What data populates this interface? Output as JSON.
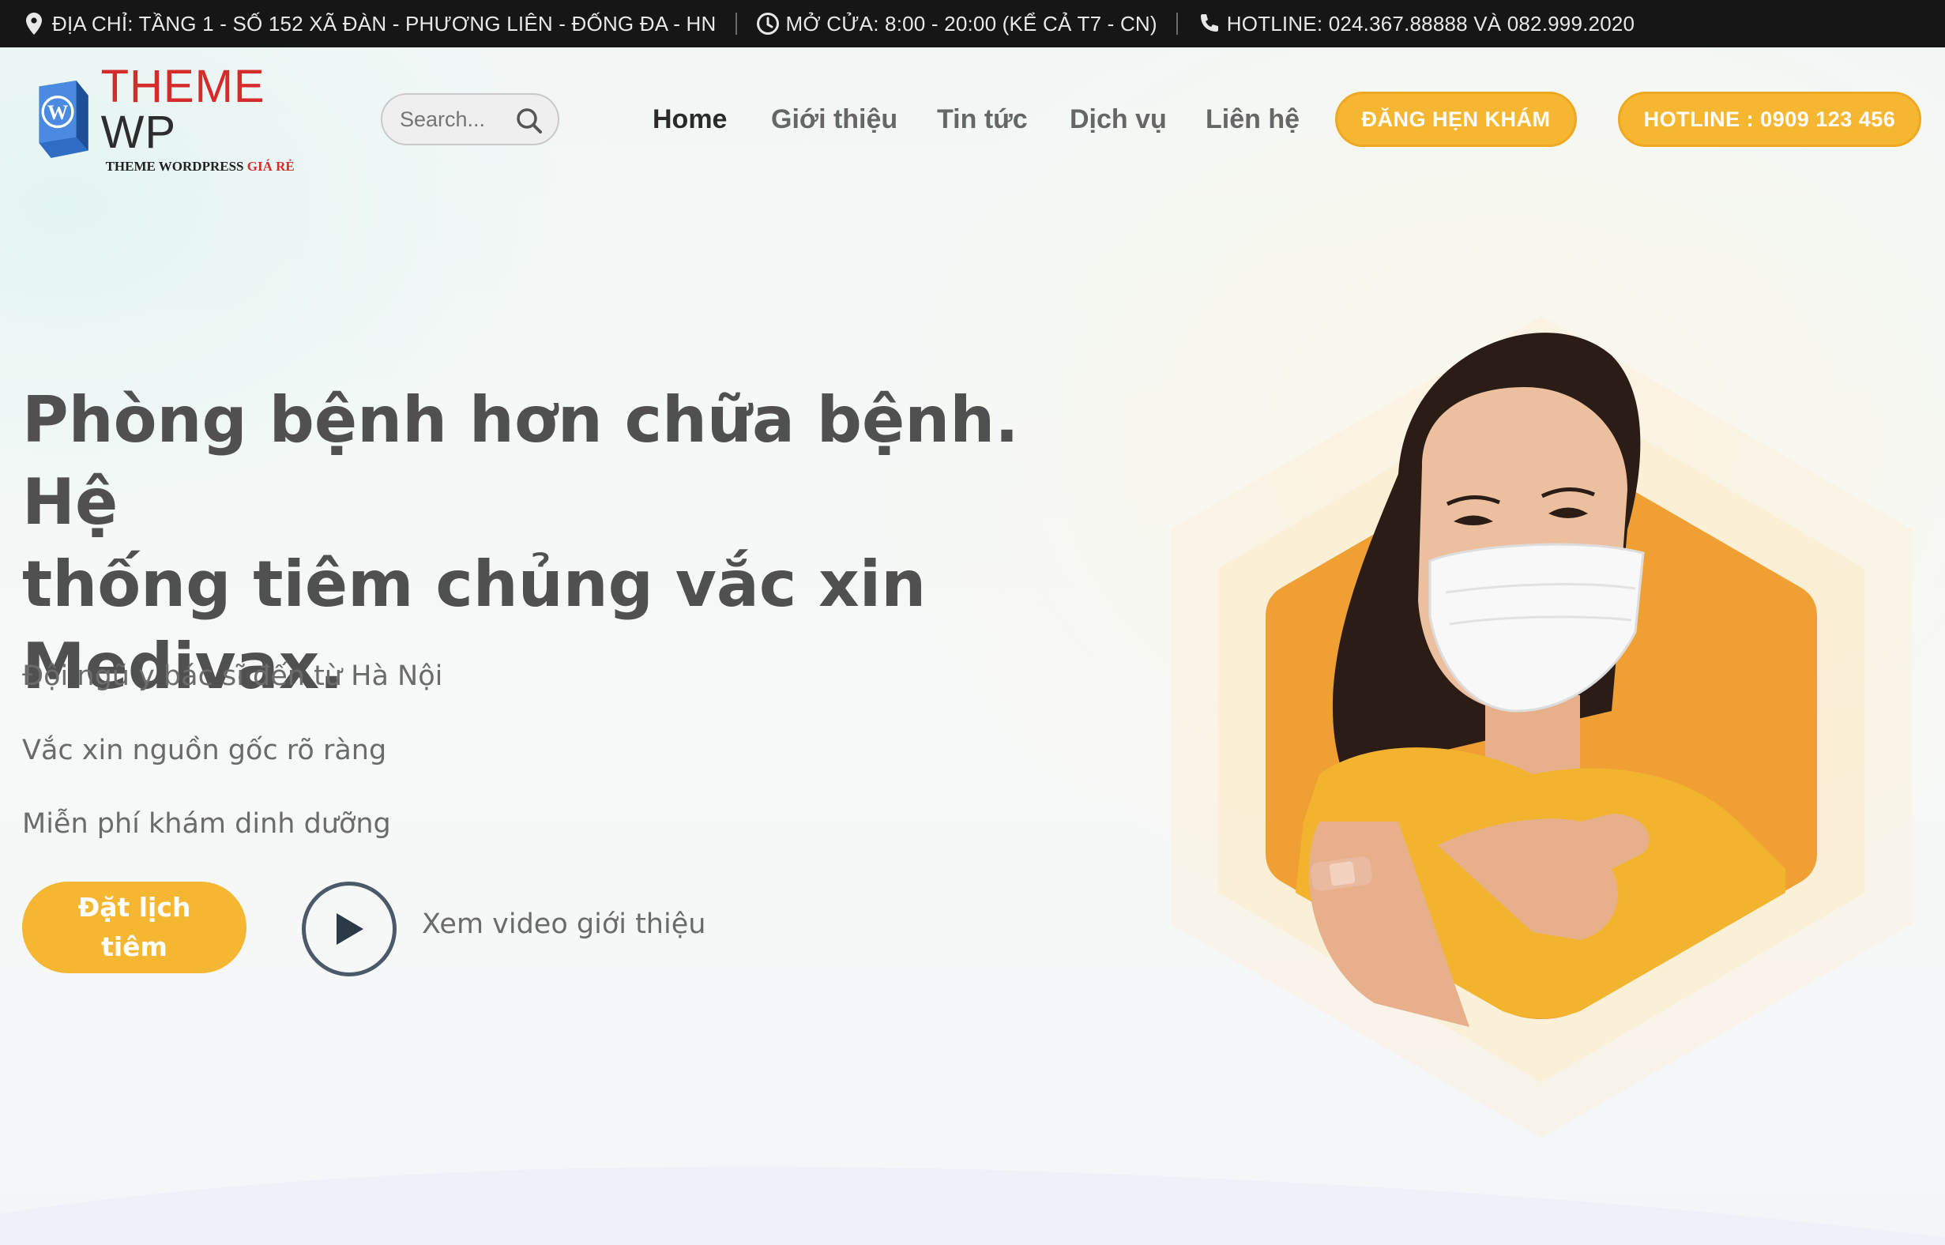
{
  "topbar": {
    "address": "ĐỊA CHỈ: TẦNG 1 - SỐ 152 XÃ ĐÀN - PHƯƠNG LIÊN - ĐỐNG ĐA - HN",
    "hours": "MỞ CỬA: 8:00 - 20:00 (KỂ CẢ T7 - CN)",
    "hotline": "HOTLINE: 024.367.88888 VÀ 082.999.2020"
  },
  "logo": {
    "main_red": "THEME",
    "main_dark": "WP",
    "sub": "THEME WORDPRESS",
    "sub_accent": "GIÁ RẺ"
  },
  "search": {
    "placeholder": "Search..."
  },
  "nav": {
    "items": [
      {
        "label": "Home"
      },
      {
        "label": "Giới thiệu"
      },
      {
        "label": "Tin tức"
      },
      {
        "label": "Dịch vụ"
      },
      {
        "label": "Liên hệ"
      }
    ],
    "appointment_button": "ĐĂNG HẸN KHÁM",
    "hotline_button": "HOTLINE : 0909 123 456"
  },
  "hero": {
    "headline_line1": "Phòng bệnh hơn chữa bệnh. Hệ",
    "headline_line2": "thống tiêm chủng vắc xin",
    "headline_line3": "Medivax.",
    "features": [
      "Đội ngũ y bác sĩ đến từ Hà Nội",
      "Vắc xin nguồn gốc rõ ràng",
      "Miễn phí khám dinh dưỡng"
    ],
    "cta_line1": "Đặt lịch",
    "cta_line2": "tiêm",
    "video_label": "Xem video giới thiệu"
  },
  "colors": {
    "accent": "#f5b731",
    "topbar_bg": "#161616",
    "hex_orange": "#f0a033",
    "headline": "#505050"
  },
  "icons": [
    "map-pin-icon",
    "clock-icon",
    "phone-icon",
    "search-icon",
    "play-icon",
    "wordpress-logo-icon"
  ]
}
